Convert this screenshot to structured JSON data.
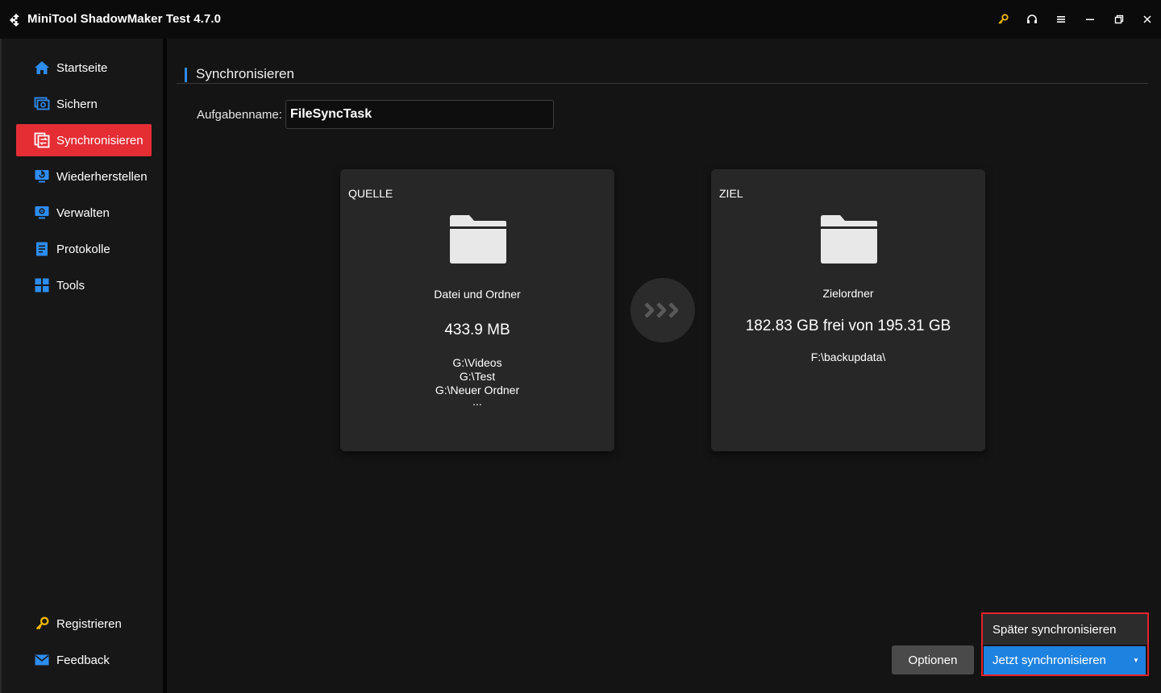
{
  "app": {
    "title": "MiniTool ShadowMaker Test 4.7.0"
  },
  "titlebar_icons": [
    "key-icon",
    "headset-icon",
    "menu-icon",
    "minimize-icon",
    "restore-icon",
    "close-icon"
  ],
  "colors": {
    "accent_red": "#e52d34",
    "accent_blue": "#1e82e0",
    "key_yellow": "#f5b800",
    "highlight_border": "#e3232c"
  },
  "sidebar": {
    "items": [
      {
        "label": "Startseite",
        "icon": "home-icon"
      },
      {
        "label": "Sichern",
        "icon": "backup-icon"
      },
      {
        "label": "Synchronisieren",
        "icon": "sync-icon",
        "active": true
      },
      {
        "label": "Wiederherstellen",
        "icon": "restore-data-icon"
      },
      {
        "label": "Verwalten",
        "icon": "manage-icon"
      },
      {
        "label": "Protokolle",
        "icon": "logs-icon"
      },
      {
        "label": "Tools",
        "icon": "tools-icon"
      }
    ],
    "bottom": [
      {
        "label": "Registrieren",
        "icon": "key-icon"
      },
      {
        "label": "Feedback",
        "icon": "mail-icon"
      }
    ]
  },
  "main": {
    "section_title": "Synchronisieren",
    "task_name_label": "Aufgabenname:",
    "task_name_value": "FileSyncTask",
    "source": {
      "label": "QUELLE",
      "subtitle": "Datei und Ordner",
      "size": "433.9 MB",
      "paths": [
        "G:\\Videos",
        "G:\\Test",
        "G:\\Neuer Ordner",
        "..."
      ]
    },
    "target": {
      "label": "ZIEL",
      "subtitle": "Zielordner",
      "size": "182.83 GB frei von 195.31 GB",
      "path": "F:\\backupdata\\"
    }
  },
  "actions": {
    "options_label": "Optionen",
    "later_label": "Später synchronisieren",
    "now_label": "Jetzt synchronisieren",
    "dropdown_arrow": "▼"
  }
}
